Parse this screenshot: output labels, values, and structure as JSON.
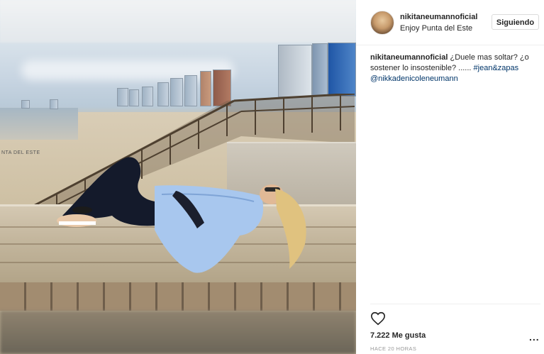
{
  "photo": {
    "beach_sign": "NTA DEL ESTE"
  },
  "header": {
    "username": "nikitaneumannoficial",
    "location": "Enjoy Punta del Este",
    "follow_label": "Siguiendo"
  },
  "caption": {
    "username": "nikitaneumannoficial",
    "text": " ¿Duele mas soltar? ¿o sostener lo insostenible? ...... ",
    "hashtag": "#jean&zapas",
    "mention": "@nikkadenicoleneumann"
  },
  "actions": {
    "like_icon": "heart-icon",
    "likes_count": "7.222 Me gusta",
    "timestamp": "HACE 20 HORAS",
    "more_label": "..."
  },
  "colors": {
    "link": "#003569",
    "text": "#262626",
    "muted": "#999999",
    "border": "#dbdbdb"
  }
}
